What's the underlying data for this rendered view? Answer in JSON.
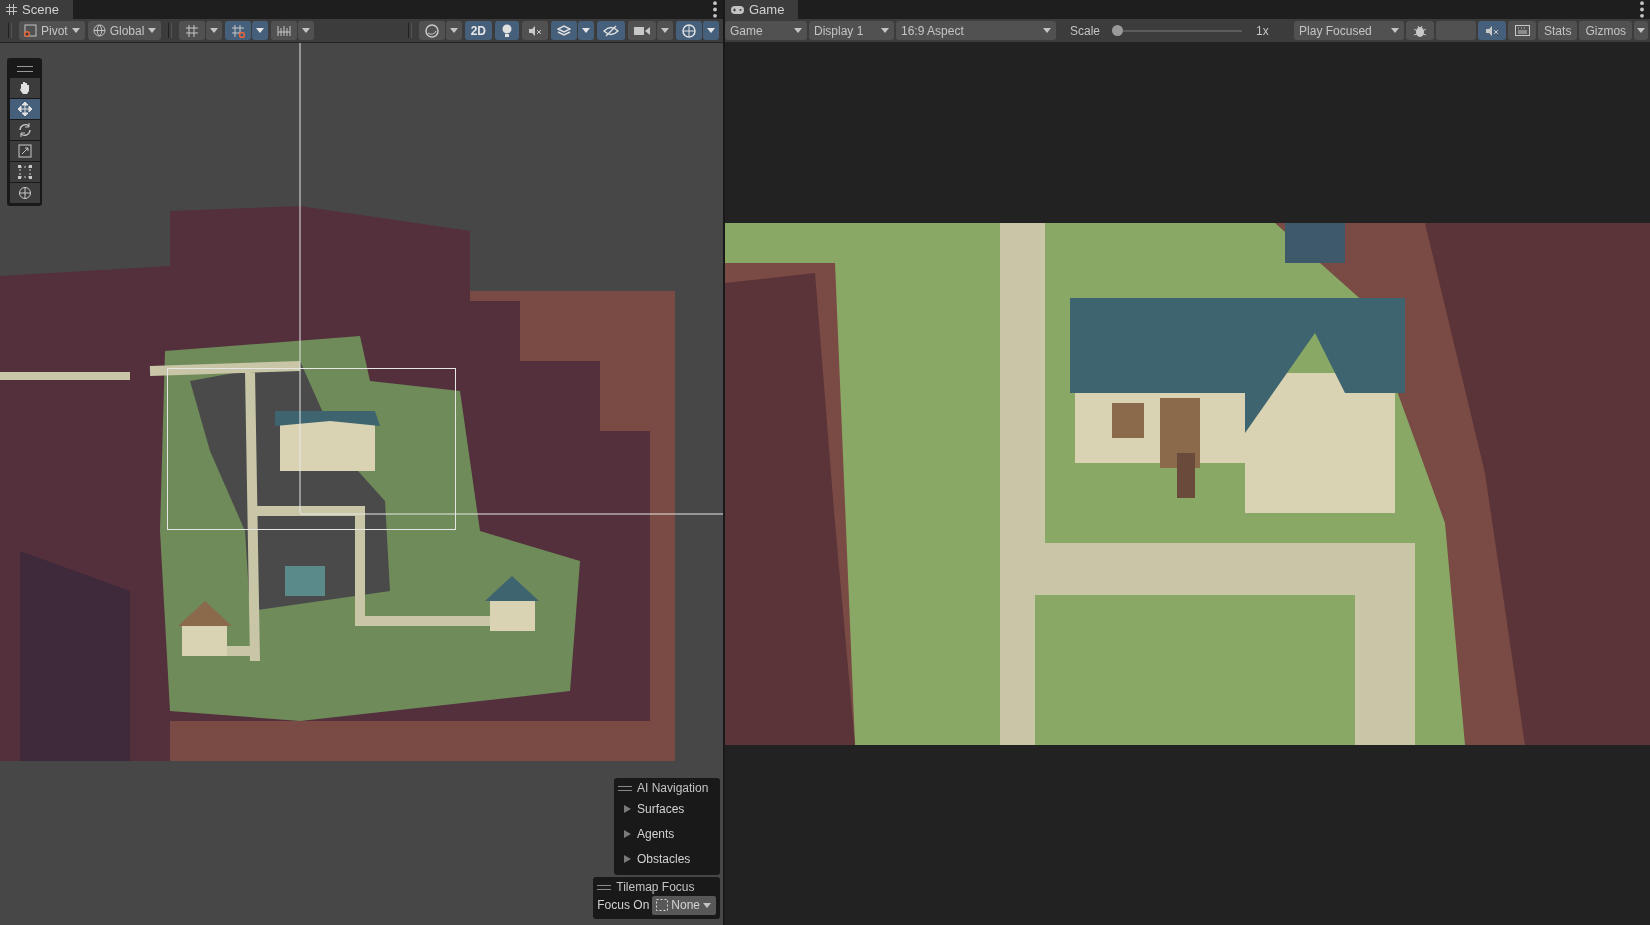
{
  "scene_panel": {
    "tab": "Scene",
    "toolbar": {
      "pivot": "Pivot",
      "space": "Global",
      "left_toggles": [
        {
          "kind": "grid",
          "selected": false,
          "dropdown": true
        },
        {
          "kind": "snap",
          "selected": true,
          "dropdown": true
        },
        {
          "kind": "increment",
          "selected": false,
          "dropdown": true
        }
      ],
      "right_toggles": [
        {
          "kind": "shading",
          "selected": false,
          "dropdown": true
        },
        {
          "kind": "text",
          "label": "2D",
          "selected": true,
          "dropdown": false
        },
        {
          "kind": "light",
          "selected": true,
          "dropdown": false
        },
        {
          "kind": "audio",
          "selected": false,
          "dropdown": false
        },
        {
          "kind": "effects",
          "selected": true,
          "dropdown": true
        },
        {
          "kind": "visibility",
          "selected": true,
          "dropdown": false
        },
        {
          "kind": "camera",
          "selected": false,
          "dropdown": true
        },
        {
          "kind": "gizmos",
          "selected": true,
          "dropdown": true
        }
      ]
    },
    "tools": [
      {
        "kind": "hand",
        "selected": false
      },
      {
        "kind": "move",
        "selected": true
      },
      {
        "kind": "rotate",
        "selected": false
      },
      {
        "kind": "scale",
        "selected": false
      },
      {
        "kind": "rect",
        "selected": false
      },
      {
        "kind": "transform",
        "selected": false
      }
    ],
    "ai_navigation": {
      "title": "AI Navigation",
      "items": [
        {
          "label": "Surfaces",
          "expanded": false
        },
        {
          "label": "Agents",
          "expanded": false
        },
        {
          "label": "Obstacles",
          "expanded": false
        }
      ]
    },
    "tilemap_focus": {
      "title": "Tilemap Focus",
      "label": "Focus On",
      "value": "None"
    }
  },
  "game_panel": {
    "tab": "Game",
    "toolbar": {
      "view": "Game",
      "display": "Display 1",
      "aspect": "16:9 Aspect",
      "scale_label": "Scale",
      "scale": {
        "level": 0
      },
      "scale_value": "1x",
      "play_mode": "Play Focused",
      "toggles": [
        {
          "kind": "bug",
          "selected": false
        },
        {
          "kind": "blank",
          "selected": false
        },
        {
          "kind": "audio",
          "selected": true
        },
        {
          "kind": "keyboard",
          "selected": false
        }
      ],
      "stats": "Stats",
      "gizmos": "Gizmos"
    }
  }
}
